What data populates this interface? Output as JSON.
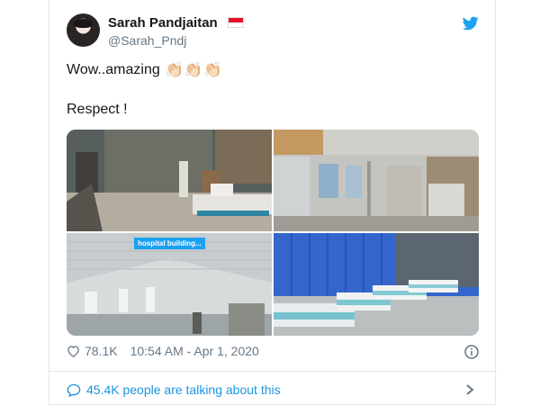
{
  "tweet": {
    "author_name": "Sarah Pandjaitan",
    "author_handle": "@Sarah_Pndj",
    "flag_icon": "indonesia-flag-icon",
    "logo_icon": "twitter-bird-icon",
    "text_line1": "Wow..amazing",
    "emoji_clap": "👏🏻👏🏻👏🏻",
    "text_line2": "Respect !",
    "media_caption": "hospital building...",
    "likes": "78.1K",
    "timestamp": "10:54 AM - Apr 1, 2020",
    "talking": "45.4K people are talking about this"
  },
  "colors": {
    "brand": "#1da1f2",
    "secondary_text": "#657786",
    "link": "#1b95e0"
  }
}
